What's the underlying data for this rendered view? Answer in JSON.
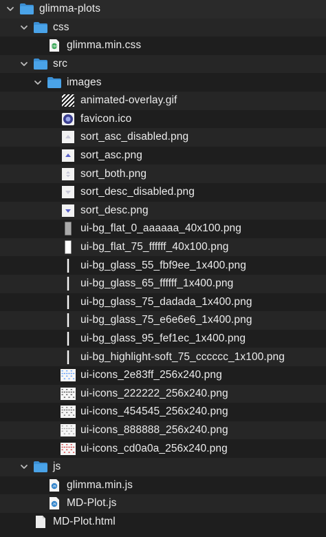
{
  "tree": [
    {
      "label": "glimma-plots",
      "type": "folder",
      "expanded": true,
      "level": 0
    },
    {
      "label": "css",
      "type": "folder",
      "expanded": true,
      "level": 1
    },
    {
      "label": "glimma.min.css",
      "type": "css",
      "level": 2
    },
    {
      "label": "src",
      "type": "folder",
      "expanded": true,
      "level": 1
    },
    {
      "label": "images",
      "type": "folder",
      "expanded": true,
      "level": 2
    },
    {
      "label": "animated-overlay.gif",
      "type": "stripes",
      "level": 3
    },
    {
      "label": "favicon.ico",
      "type": "favicon",
      "level": 3
    },
    {
      "label": "sort_asc_disabled.png",
      "type": "sort-asc-disabled",
      "level": 3
    },
    {
      "label": "sort_asc.png",
      "type": "sort-asc",
      "level": 3
    },
    {
      "label": "sort_both.png",
      "type": "sort-both",
      "level": 3
    },
    {
      "label": "sort_desc_disabled.png",
      "type": "sort-desc-disabled",
      "level": 3
    },
    {
      "label": "sort_desc.png",
      "type": "sort-desc",
      "level": 3
    },
    {
      "label": "ui-bg_flat_0_aaaaaa_40x100.png",
      "type": "bar-gray",
      "level": 3
    },
    {
      "label": "ui-bg_flat_75_ffffff_40x100.png",
      "type": "bar-white",
      "level": 3
    },
    {
      "label": "ui-bg_glass_55_fbf9ee_1x400.png",
      "type": "line",
      "level": 3
    },
    {
      "label": "ui-bg_glass_65_ffffff_1x400.png",
      "type": "line",
      "level": 3
    },
    {
      "label": "ui-bg_glass_75_dadada_1x400.png",
      "type": "line",
      "level": 3
    },
    {
      "label": "ui-bg_glass_75_e6e6e6_1x400.png",
      "type": "line",
      "level": 3
    },
    {
      "label": "ui-bg_glass_95_fef1ec_1x400.png",
      "type": "line",
      "level": 3
    },
    {
      "label": "ui-bg_highlight-soft_75_cccccc_1x100.png",
      "type": "line",
      "level": 3
    },
    {
      "label": "ui-icons_2e83ff_256x240.png",
      "type": "sprite",
      "tint": "#2e83ff",
      "level": 3
    },
    {
      "label": "ui-icons_222222_256x240.png",
      "type": "sprite",
      "tint": "#222222",
      "level": 3
    },
    {
      "label": "ui-icons_454545_256x240.png",
      "type": "sprite",
      "tint": "#454545",
      "level": 3
    },
    {
      "label": "ui-icons_888888_256x240.png",
      "type": "sprite",
      "tint": "#888888",
      "level": 3
    },
    {
      "label": "ui-icons_cd0a0a_256x240.png",
      "type": "sprite",
      "tint": "#cd0a0a",
      "level": 3
    },
    {
      "label": "js",
      "type": "folder",
      "expanded": true,
      "level": 1
    },
    {
      "label": "glimma.min.js",
      "type": "js",
      "level": 2
    },
    {
      "label": "MD-Plot.js",
      "type": "js",
      "level": 2
    },
    {
      "label": "MD-Plot.html",
      "type": "file",
      "level": 1
    }
  ],
  "colors": {
    "folder": "#4aa3e8",
    "folder_tab": "#3b8fd4",
    "chevron": "#bdbdbd",
    "row_alt": "#262626",
    "background": "#1e1e1e"
  }
}
